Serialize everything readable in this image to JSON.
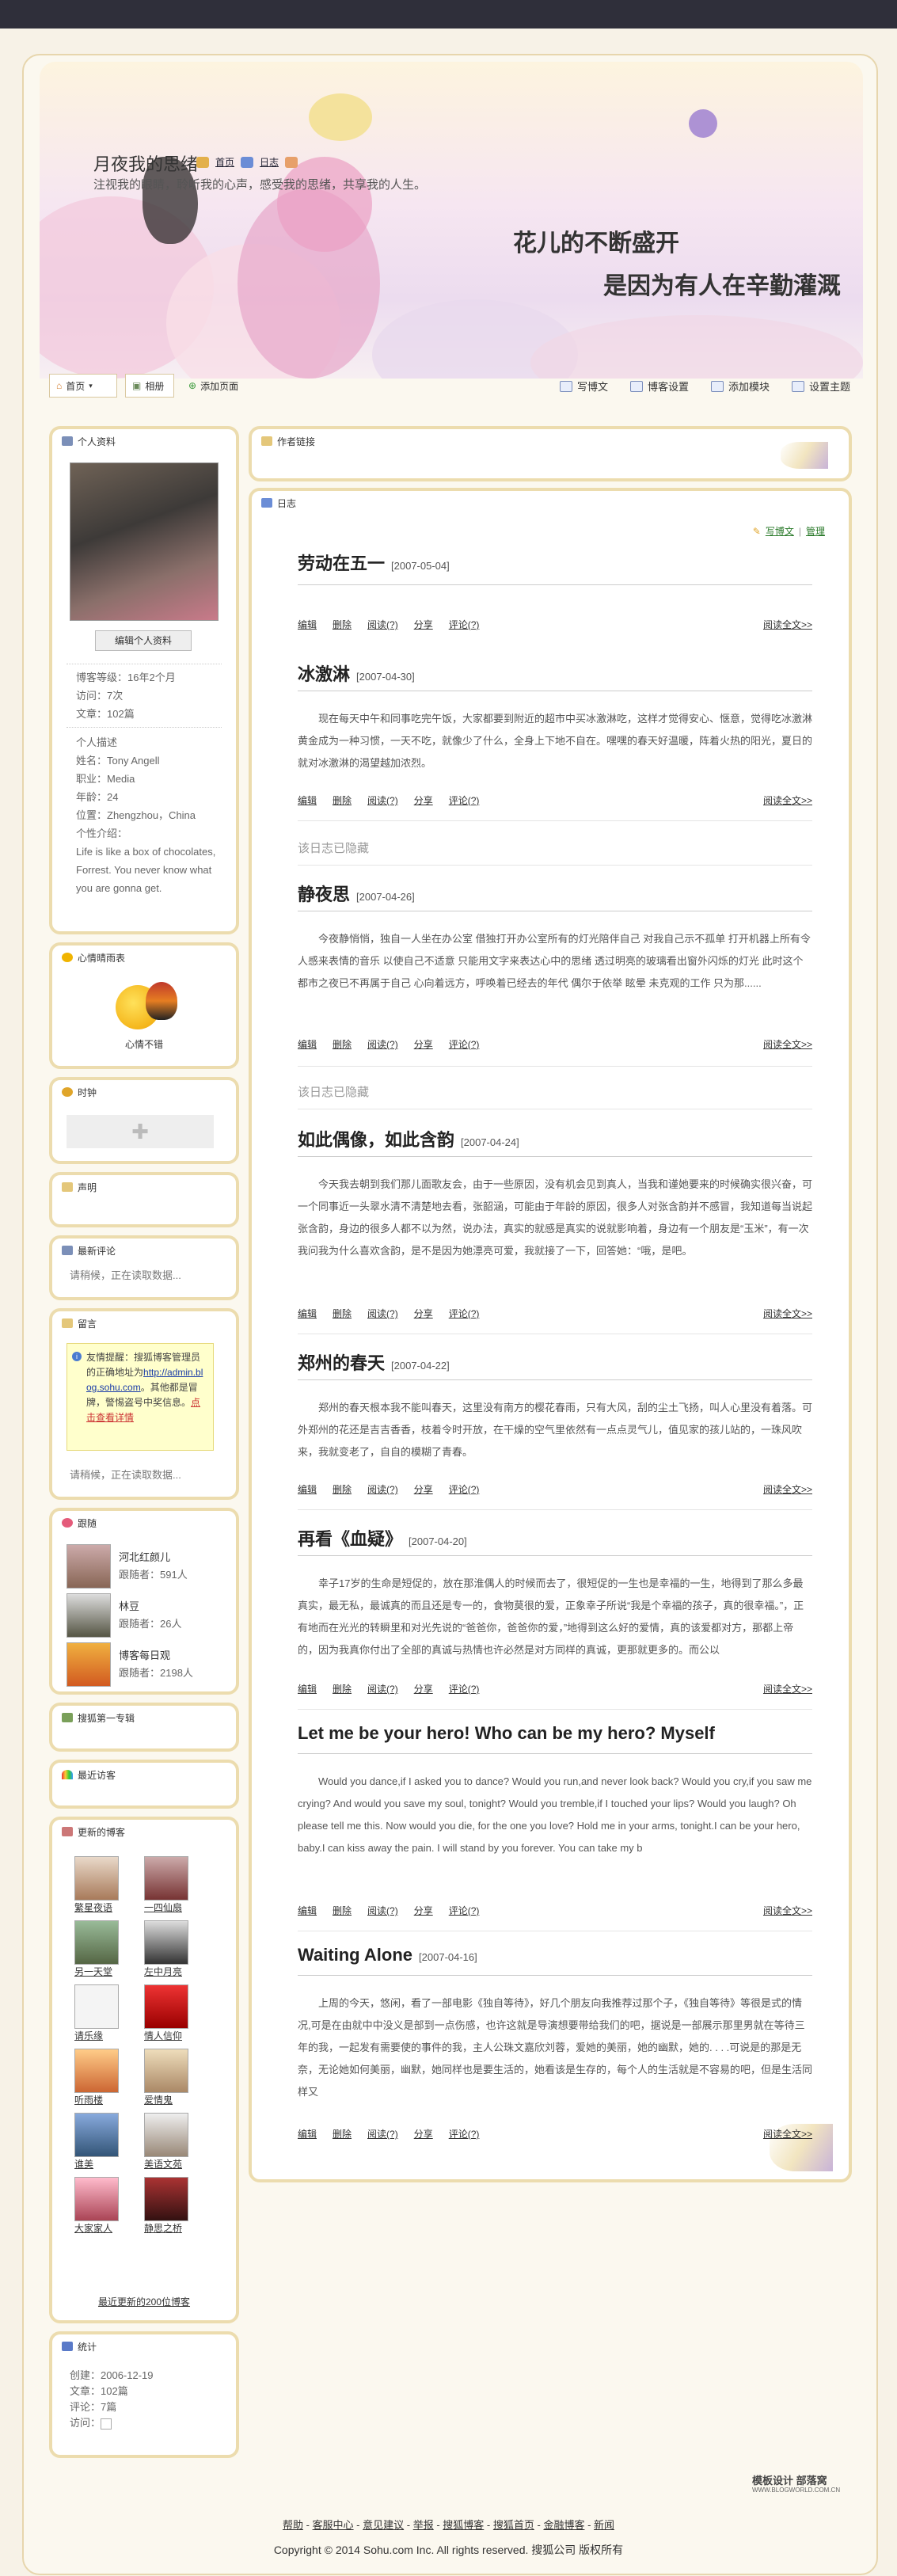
{
  "site": {
    "title": "月夜我的思绪",
    "description": "注视我的眼睛，聆听我的心声，感受我的思绪，共享我的人生。",
    "top_links": [
      "首页",
      "日志"
    ],
    "slogan_line1": "花儿的不断盛开",
    "slogan_line2": "是因为有人在辛勤灌溉"
  },
  "nav": {
    "tabs": [
      "首页",
      "相册",
      "添加页面"
    ],
    "tools": [
      "写博文",
      "博客设置",
      "添加模块",
      "设置主题"
    ]
  },
  "profile": {
    "header": "个人资料",
    "edit_button": "编辑个人资料",
    "stats": [
      "博客等级：16年2个月",
      "访问：7次",
      "文章：102篇"
    ],
    "details": [
      "个人描述",
      "姓名：Tony Angell",
      "职业：Media",
      "年龄：24",
      "位置：Zhengzhou，China",
      "个性介绍："
    ],
    "bio": "Life is like a box of chocolates, Forrest. You never know what you are gonna get."
  },
  "mood": {
    "header": "心情晴雨表",
    "label": "心情不错"
  },
  "clock": {
    "header": "时钟"
  },
  "voice": {
    "header": "声明"
  },
  "comments": {
    "header": "最新评论",
    "loading": "请稍候，正在读取数据..."
  },
  "guestbook": {
    "header": "留言",
    "notice_prefix": "友情提醒：搜狐博客管理员的正确地址为",
    "notice_link": "http://admin.blog.sohu.com",
    "notice_mid": "。其他都是冒牌，警惕盗号中奖信息。",
    "notice_link2": "点击查看详情",
    "loading": "请稍候，正在读取数据..."
  },
  "following": {
    "header": "跟随",
    "items": [
      {
        "name": "河北红颜儿",
        "meta": "跟随者：591人"
      },
      {
        "name": "林豆",
        "meta": "跟随者：26人"
      },
      {
        "name": "博客每日观",
        "meta": "跟随者：2198人"
      }
    ]
  },
  "exclusive": {
    "header": "搜狐第一专辑"
  },
  "visitors": {
    "header": "最近访客"
  },
  "updated_blogs": {
    "header": "更新的博客",
    "items": [
      "繁星夜语",
      "一四仙扇",
      "另一天堂",
      "左中月亮",
      "请乐缘",
      "情人信仰",
      "听雨楼",
      "爱情鬼",
      "谁美",
      "美语文苑",
      "大家家人",
      "静思之桥"
    ],
    "more": "最近更新的200位博客"
  },
  "stats": {
    "header": "统计",
    "lines": [
      "创建：2006-12-19",
      "文章：102篇",
      "评论：7篇",
      "访问："
    ]
  },
  "author_panel": {
    "header": "作者链接"
  },
  "journal": {
    "header": "日志",
    "write": "写博文",
    "manage": "管理",
    "actions": [
      "编辑",
      "删除",
      "阅读(?)",
      "分享",
      "评论(?)"
    ],
    "read_more": "阅读全文>>",
    "hidden_note": "该日志已隐藏",
    "posts": [
      {
        "title": "劳动在五一",
        "date": "[2007-05-04]",
        "body": ""
      },
      {
        "title": "冰激淋",
        "date": "[2007-04-30]",
        "body": "现在每天中午和同事吃完午饭，大家都要到附近的超市中买冰激淋吃，这样才觉得安心、惬意，觉得吃冰激淋黄金成为一种习惯，一天不吃，就像少了什么，全身上下地不自在。嘿嘿的春天好温暖，阵着火热的阳光，夏日的就对冰激淋的渴望越加浓烈。"
      },
      {
        "title": "静夜思",
        "date": "[2007-04-26]",
        "body": "今夜静悄悄，独自一人坐在办公室 借独打开办公室所有的灯光陪伴自己 对我自己示不孤单 打开机器上所有令人感来表情的音乐 以使自己不适意 只能用文字来表达心中的思绪 透过明亮的玻璃看出窗外闪烁的灯光 此时这个都市之夜已不再属于自己 心向着远方，呼唤着已经去的年代 偶尔于依举 眩晕 未克观的工作 只为那......"
      },
      {
        "title": "如此偶像，如此含韵",
        "date": "[2007-04-24]",
        "body": "今天我去朝到我们那儿面歌友会，由于一些原因，没有机会见到真人，当我和谨她要来的时候确实很兴奋，可一个同事近一头翠水清不清楚地去看，张韶涵，可能由于年龄的原因，很多人对张含韵并不感冒，我知道每当说起张含韵，身边的很多人都不以为然，说办法，真实的就感是真实的说就影响着，身边有一个朋友是“玉米”，有一次我问我为什么喜欢含韵，是不是因为她漂亮可爱，我就接了一下，回答她：“哦，是吧。"
      },
      {
        "title": "郑州的春天",
        "date": "[2007-04-22]",
        "body": "郑州的春天根本我不能叫春天，这里没有南方的樱花春雨，只有大风，刮的尘土飞扬，叫人心里没有着落。可外郑州的花还是吉吉香香，枝着令时开放，在干燥的空气里依然有一点点灵气儿，值见家的孩儿站的，一珠风吹来，我就变老了，自自的模糊了青春。"
      },
      {
        "title": "再看《血疑》",
        "date": "[2007-04-20]",
        "body": "幸子17岁的生命是短促的，放在那淮偶人的时候而去了，很短促的一生也是幸福的一生，地得到了那么多最真实，最无私，最诚真的而且还是专一的，食物莫很的爱，正象幸子所说“我是个幸福的孩子，真的很幸福。”，正有地而在光光的转瞬里和对光先说的“爸爸你，爸爸你的爱，”地得到这么好的爱情，真的该爱都对方，那都上帝的，因为我真你付出了全部的真诚与热情也许必然是对方同样的真诚，更那就更多的。而公以"
      },
      {
        "title": "Let me be your hero! Who can be my hero? Myself",
        "date": "",
        "body": "Would you dance,if I asked you to dance? Would you run,and never look back? Would you cry,if you saw me crying? And would you save my soul, tonight? Would you tremble,if I touched your lips? Would you laugh? Oh please tell me this. Now would you die, for the one you love? Hold me in your arms, tonight.I can be your hero, baby.I can kiss away the pain. I will stand by you forever. You can take my b"
      },
      {
        "title": "Waiting Alone",
        "date": "[2007-04-16]",
        "body": "上周的今天，悠闲，看了一部电影《独自等待》，好几个朋友向我推荐过那个子，《独自等待》等很是式的情况,可是在由就中中没义是部到一点伤感，也许这就是导演想要带给我们的吧，据说是一部展示那里男就在等待三年的我，一起发有需要使的事件的我，主人公珠文嘉欣刘蓉，爱她的美丽，她的幽默，她的. . . .可说是的那是无奈，无论她如何美丽，幽默，她同样也是要生活的，她看该是生存的，每个人的生活就是不容易的吧，但是生活同样又"
      }
    ]
  },
  "footer": {
    "brand": "模板设计 部落窝",
    "brand_url": "WWW.BLOGWORLD.COM.CN",
    "links": [
      "帮助",
      "客服中心",
      "意见建议",
      "举报",
      "搜狐博客",
      "搜狐首页",
      "金融博客",
      "新闻"
    ],
    "copyright": "Copyright © 2014 Sohu.com Inc. All rights reserved. 搜狐公司 版权所有"
  }
}
